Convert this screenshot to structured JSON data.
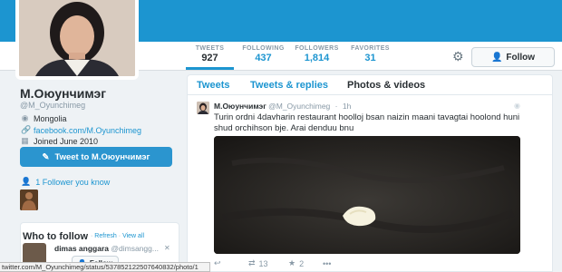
{
  "stats": [
    {
      "label": "TWEETS",
      "value": "927"
    },
    {
      "label": "FOLLOWING",
      "value": "437"
    },
    {
      "label": "FOLLOWERS",
      "value": "1,814"
    },
    {
      "label": "FAVORITES",
      "value": "31"
    }
  ],
  "actions": {
    "follow_label": "Follow",
    "gear_icon": "gear-icon"
  },
  "profile": {
    "name": "М.Оюунчимэг",
    "handle": "@M_Oyunchimeg",
    "location": "Mongolia",
    "website": "facebook.com/M.Oyunchimeg",
    "joined": "Joined June 2010",
    "tweet_to_label": "Tweet to М.Оюунчимэг",
    "followers_you_know": "1 Follower you know"
  },
  "who_to_follow": {
    "title": "Who to follow",
    "refresh": "Refresh",
    "separator": "·",
    "view_all": "View all",
    "suggestion": {
      "name": "dimas anggara",
      "handle": "@dimsangg...",
      "follow_label": "Follow"
    }
  },
  "tabs": [
    "Tweets",
    "Tweets & replies",
    "Photos & videos"
  ],
  "tweet": {
    "name": "М.Оюунчимэг",
    "handle": "@M_Oyunchimeg",
    "separator": "·",
    "time": "1h",
    "text": "Turin ordni 4davharin restaurant hoolloj bsan naizin maani tavagtai hoolond huni shud orchihson bje. Arai denduu bnu",
    "retweets": "13",
    "favorites": "2"
  },
  "status_url": "twitter.com/M_Oyunchimeg/status/537852122507640832/photo/1",
  "colors": {
    "brand": "#1c95d0",
    "text": "#292f33",
    "muted": "#8899a6"
  }
}
